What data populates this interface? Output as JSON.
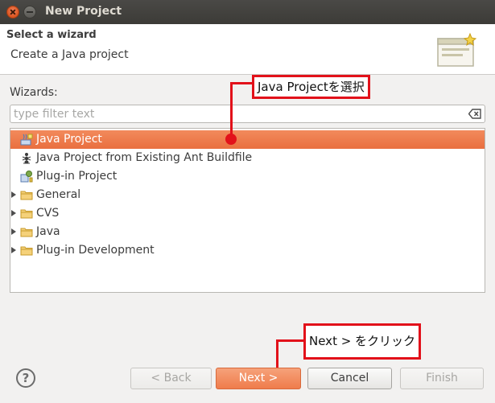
{
  "window": {
    "title": "New Project"
  },
  "header": {
    "title": "Select a wizard",
    "description": "Create a Java project"
  },
  "wizards": {
    "label": "Wizards:",
    "filter_placeholder": "type filter text",
    "filter_value": "",
    "items": [
      {
        "label": "Java Project",
        "icon": "java-project-icon",
        "expandable": false,
        "selected": true
      },
      {
        "label": "Java Project from Existing Ant Buildfile",
        "icon": "ant-icon",
        "expandable": false,
        "selected": false
      },
      {
        "label": "Plug-in Project",
        "icon": "plugin-project-icon",
        "expandable": false,
        "selected": false
      },
      {
        "label": "General",
        "icon": "folder-icon",
        "expandable": true,
        "selected": false
      },
      {
        "label": "CVS",
        "icon": "folder-icon",
        "expandable": true,
        "selected": false
      },
      {
        "label": "Java",
        "icon": "folder-icon",
        "expandable": true,
        "selected": false
      },
      {
        "label": "Plug-in Development",
        "icon": "folder-icon",
        "expandable": true,
        "selected": false
      }
    ]
  },
  "annotations": {
    "select_java_project": "Java Projectを選択",
    "click_next": "Next > をクリック"
  },
  "buttons": {
    "help": "?",
    "back": "< Back",
    "next": "Next >",
    "cancel": "Cancel",
    "finish": "Finish"
  },
  "colors": {
    "selection": "#ef7c4c",
    "annotation_red": "#e2111a",
    "titlebar": "#3c3b37"
  }
}
